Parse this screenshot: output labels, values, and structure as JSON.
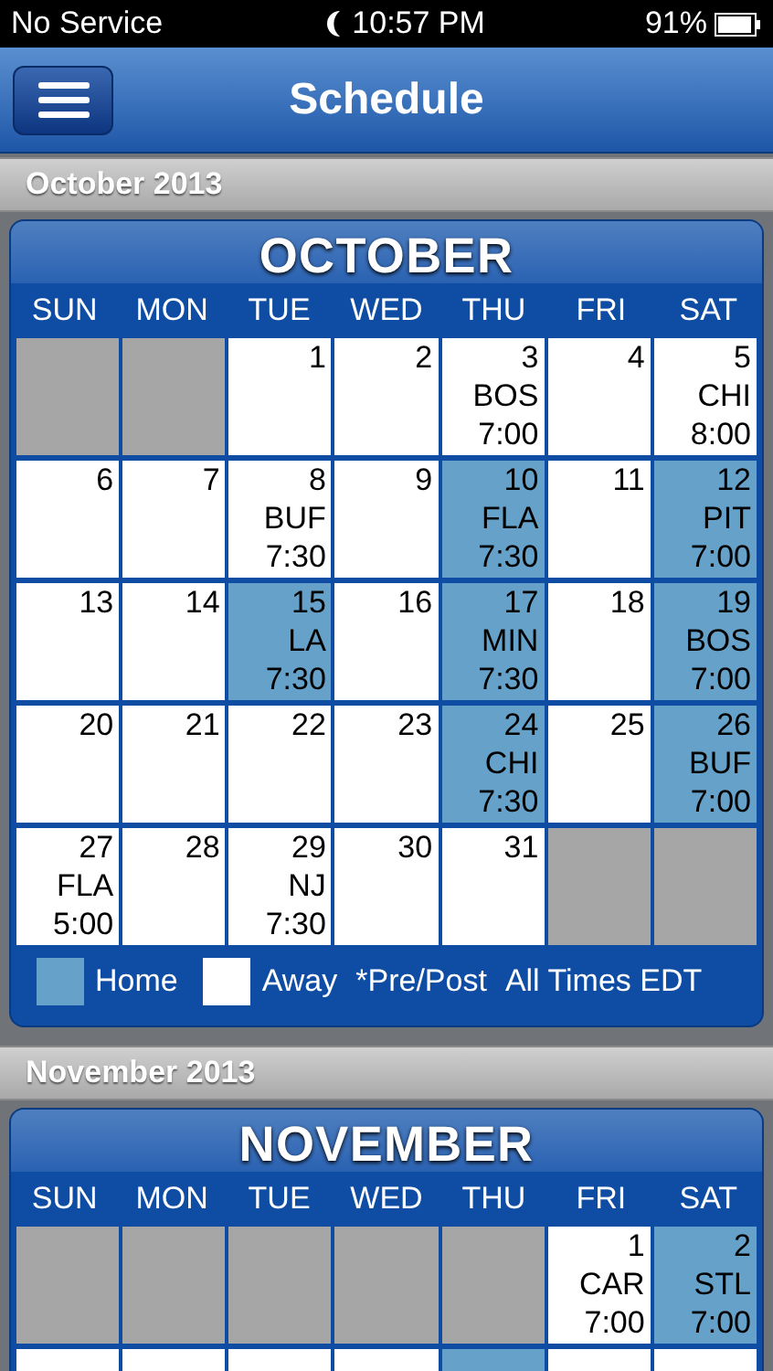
{
  "status_bar": {
    "carrier": "No Service",
    "time": "10:57 PM",
    "battery": "91%"
  },
  "nav_bar": {
    "title": "Schedule"
  },
  "months": [
    {
      "header": "October 2013",
      "title": "OCTOBER",
      "weekdays": [
        "SUN",
        "MON",
        "TUE",
        "WED",
        "THU",
        "FRI",
        "SAT"
      ],
      "weeks": [
        [
          {
            "kind": "empty"
          },
          {
            "kind": "empty"
          },
          {
            "kind": "away",
            "day": "1"
          },
          {
            "kind": "away",
            "day": "2"
          },
          {
            "kind": "away",
            "day": "3",
            "opponent": "BOS",
            "time": "7:00"
          },
          {
            "kind": "away",
            "day": "4"
          },
          {
            "kind": "away",
            "day": "5",
            "opponent": "CHI",
            "time": "8:00"
          }
        ],
        [
          {
            "kind": "away",
            "day": "6"
          },
          {
            "kind": "away",
            "day": "7"
          },
          {
            "kind": "away",
            "day": "8",
            "opponent": "BUF",
            "time": "7:30"
          },
          {
            "kind": "away",
            "day": "9"
          },
          {
            "kind": "home",
            "day": "10",
            "opponent": "FLA",
            "time": "7:30"
          },
          {
            "kind": "away",
            "day": "11"
          },
          {
            "kind": "home",
            "day": "12",
            "opponent": "PIT",
            "time": "7:00"
          }
        ],
        [
          {
            "kind": "away",
            "day": "13"
          },
          {
            "kind": "away",
            "day": "14"
          },
          {
            "kind": "home",
            "day": "15",
            "opponent": "LA",
            "time": "7:30"
          },
          {
            "kind": "away",
            "day": "16"
          },
          {
            "kind": "home",
            "day": "17",
            "opponent": "MIN",
            "time": "7:30"
          },
          {
            "kind": "away",
            "day": "18"
          },
          {
            "kind": "home",
            "day": "19",
            "opponent": "BOS",
            "time": "7:00"
          }
        ],
        [
          {
            "kind": "away",
            "day": "20"
          },
          {
            "kind": "away",
            "day": "21"
          },
          {
            "kind": "away",
            "day": "22"
          },
          {
            "kind": "away",
            "day": "23"
          },
          {
            "kind": "home",
            "day": "24",
            "opponent": "CHI",
            "time": "7:30"
          },
          {
            "kind": "away",
            "day": "25"
          },
          {
            "kind": "home",
            "day": "26",
            "opponent": "BUF",
            "time": "7:00"
          }
        ],
        [
          {
            "kind": "away",
            "day": "27",
            "opponent": "FLA",
            "time": "5:00"
          },
          {
            "kind": "away",
            "day": "28"
          },
          {
            "kind": "away",
            "day": "29",
            "opponent": "NJ",
            "time": "7:30"
          },
          {
            "kind": "away",
            "day": "30"
          },
          {
            "kind": "away",
            "day": "31"
          },
          {
            "kind": "empty"
          },
          {
            "kind": "empty"
          }
        ]
      ],
      "legend": {
        "home": "Home",
        "away": "Away",
        "preseason": "*Pre/Post",
        "timezone": "All Times EDT"
      }
    },
    {
      "header": "November 2013",
      "title": "NOVEMBER",
      "weekdays": [
        "SUN",
        "MON",
        "TUE",
        "WED",
        "THU",
        "FRI",
        "SAT"
      ],
      "weeks": [
        [
          {
            "kind": "empty"
          },
          {
            "kind": "empty"
          },
          {
            "kind": "empty"
          },
          {
            "kind": "empty"
          },
          {
            "kind": "empty"
          },
          {
            "kind": "away",
            "day": "1",
            "opponent": "CAR",
            "time": "7:00"
          },
          {
            "kind": "home",
            "day": "2",
            "opponent": "STL",
            "time": "7:00"
          }
        ],
        [
          {
            "kind": "away"
          },
          {
            "kind": "away"
          },
          {
            "kind": "away"
          },
          {
            "kind": "away"
          },
          {
            "kind": "home"
          },
          {
            "kind": "away"
          },
          {
            "kind": "away"
          }
        ]
      ]
    }
  ]
}
